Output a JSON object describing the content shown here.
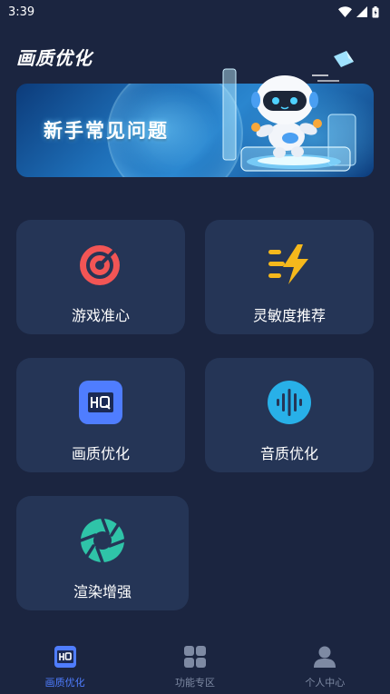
{
  "status_bar": {
    "time": "3:39"
  },
  "app": {
    "title": "画质优化"
  },
  "banner": {
    "text": "新手常见问题"
  },
  "cards": [
    {
      "label": "游戏准心",
      "icon": "target-icon",
      "color": "#f25555"
    },
    {
      "label": "灵敏度推荐",
      "icon": "lightning-icon",
      "color": "#f5b81c"
    },
    {
      "label": "画质优化",
      "icon": "hq-icon",
      "color": "#4f7dff"
    },
    {
      "label": "音质优化",
      "icon": "sound-wave-icon",
      "color": "#28b0e8"
    },
    {
      "label": "渲染增强",
      "icon": "aperture-icon",
      "color": "#2fc4a8"
    }
  ],
  "tabs": [
    {
      "label": "画质优化",
      "icon": "hq-icon",
      "active": true
    },
    {
      "label": "功能专区",
      "icon": "grid-icon",
      "active": false
    },
    {
      "label": "个人中心",
      "icon": "person-icon",
      "active": false
    }
  ],
  "colors": {
    "background": "#1b2540",
    "card": "#253556",
    "accent": "#4f7dff",
    "tab_inactive": "#7e8aa3"
  }
}
